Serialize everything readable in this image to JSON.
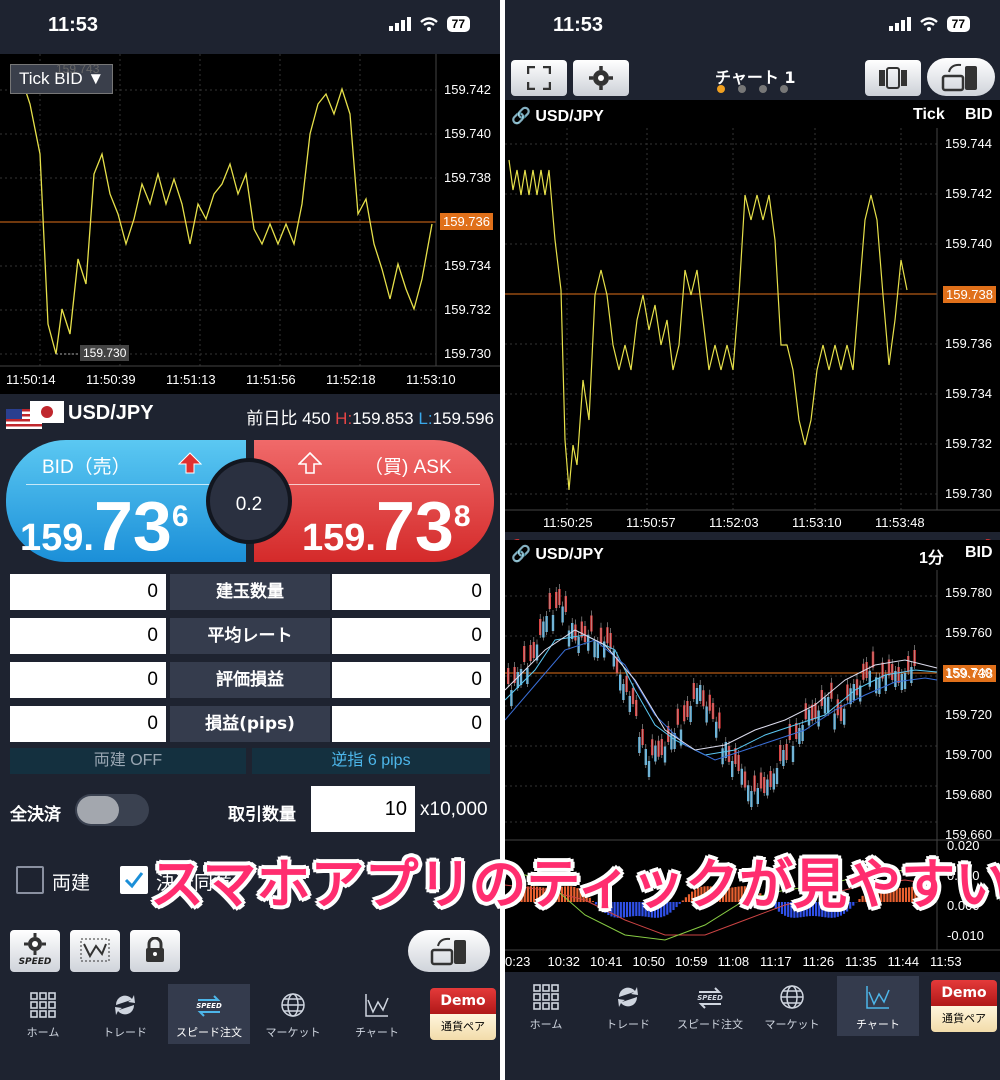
{
  "status": {
    "time": "11:53",
    "battery": "77"
  },
  "left": {
    "chart": {
      "selector": "Tick BID",
      "ghost_label": "159.743",
      "current_price": "159.736",
      "low_label": "159.730",
      "y_labels": [
        "159.742",
        "159.740",
        "159.738",
        "159.736",
        "159.734",
        "159.732",
        "159.730"
      ],
      "x_labels": [
        "11:50:14",
        "11:50:39",
        "11:51:13",
        "11:51:56",
        "11:52:18",
        "11:53:10"
      ]
    },
    "quote": {
      "pair": "USD/JPY",
      "change_label": "前日比",
      "change_value": "450",
      "high_label": "H:",
      "high_value": "159.853",
      "low_label": "L:",
      "low_value": "159.596"
    },
    "bid": {
      "label": "BID（売）",
      "price_a": "159.",
      "price_b": "73",
      "price_c": "6"
    },
    "ask": {
      "label": "（買) ASK",
      "price_a": "159.",
      "price_b": "73",
      "price_c": "8"
    },
    "spread": "0.2",
    "grid": [
      {
        "label": "建玉数量",
        "left": "0",
        "right": "0"
      },
      {
        "label": "平均レート",
        "left": "0",
        "right": "0"
      },
      {
        "label": "評価損益",
        "left": "0",
        "right": "0"
      },
      {
        "label": "損益(pips)",
        "left": "0",
        "right": "0"
      }
    ],
    "toggle_hedge": "両建 OFF",
    "toggle_stop": "逆指 6 pips",
    "close_all": "全決済",
    "qty_label": "取引数量",
    "qty_value": "10",
    "qty_unit": "x10,000",
    "chk_hedge": "両建",
    "chk_settle": "決済同意",
    "speed_label": "SPEED"
  },
  "nav": {
    "items": [
      "ホーム",
      "トレード",
      "スピード注文",
      "マーケット",
      "チャート"
    ],
    "speed_icon_text": "SPEED",
    "demo": "Demo",
    "currency": "通貨ペア"
  },
  "right": {
    "title": "チャート 1",
    "top_chart": {
      "pair": "USD/JPY",
      "type": "Tick",
      "side": "BID",
      "current_price": "159.738",
      "y_labels": [
        "159.744",
        "159.742",
        "159.740",
        "159.738",
        "159.736",
        "159.734",
        "159.732",
        "159.730"
      ],
      "x_labels": [
        "11:50:25",
        "11:50:57",
        "11:52:03",
        "11:53:10",
        "11:53:48"
      ]
    },
    "bottom_chart": {
      "pair": "USD/JPY",
      "timeframe": "1分",
      "side": "BID",
      "current_price": "159.738",
      "y_labels": [
        "159.780",
        "159.760",
        "159.740",
        "159.720",
        "159.700",
        "159.680",
        "159.660"
      ],
      "macd_labels": [
        "0.020",
        "0.010",
        "0.000",
        "-0.010"
      ],
      "x_labels": [
        "0:23",
        "10:32",
        "10:41",
        "10:50",
        "10:59",
        "11:08",
        "11:17",
        "11:26",
        "11:35",
        "11:44",
        "11:53"
      ]
    }
  },
  "banner": "スマホアプリのティックが見やすい",
  "colors": {
    "bid": "#1b8fd8",
    "ask": "#d42a2a",
    "price_line": "#e0701a",
    "tick": "#e6e04a",
    "banner": "#ff2d6f"
  }
}
